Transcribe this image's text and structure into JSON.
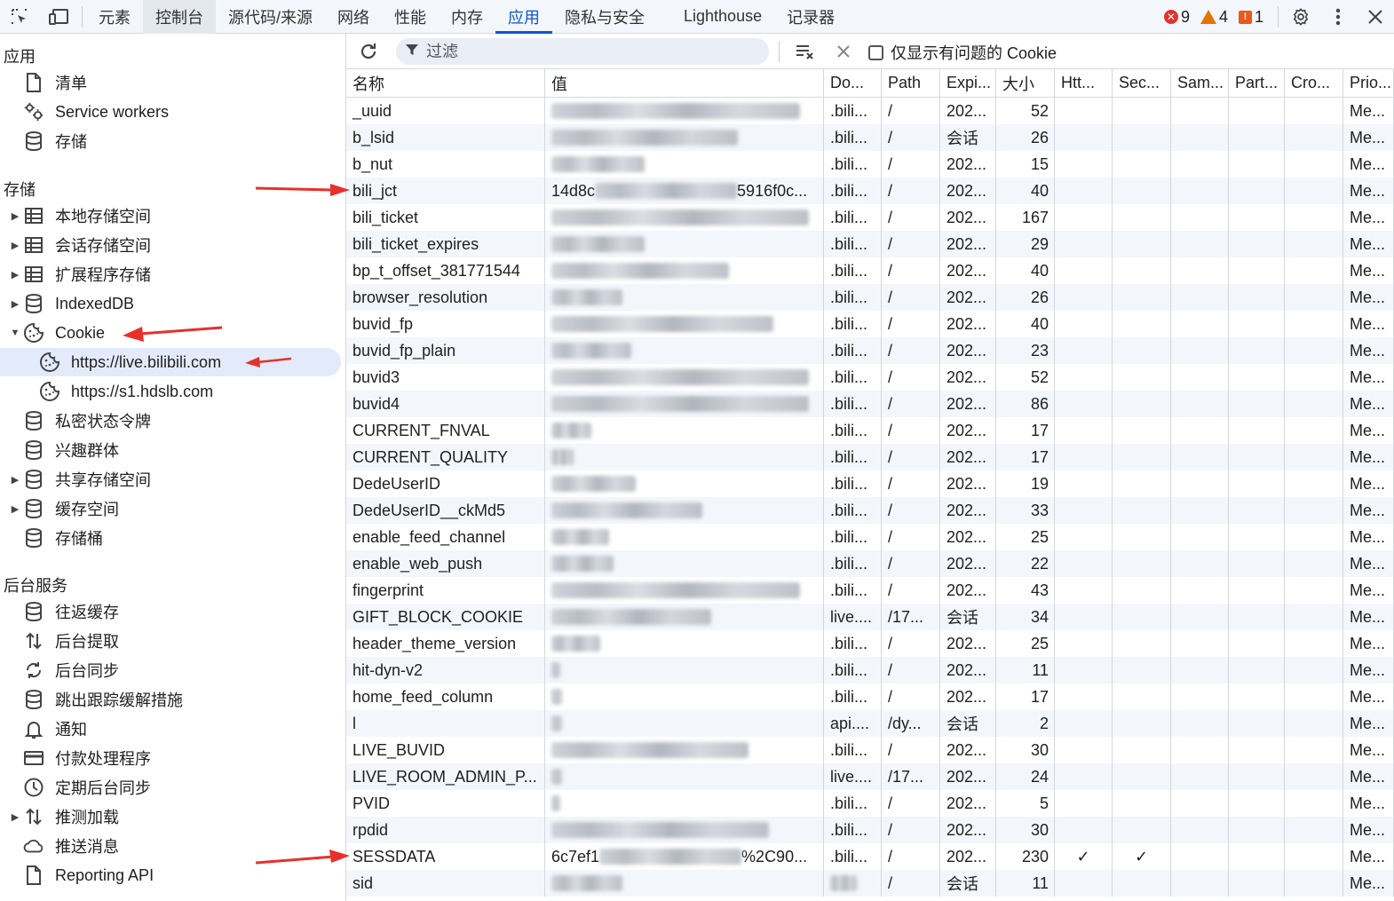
{
  "toolbar": {
    "tabs": [
      "元素",
      "控制台",
      "源代码/来源",
      "网络",
      "性能",
      "内存",
      "应用",
      "隐私与安全",
      "Lighthouse",
      "记录器"
    ],
    "errors": "9",
    "warnings": "4",
    "issues": "1"
  },
  "sidebar": {
    "section_app": "应用",
    "app_items": [
      "清单",
      "Service workers",
      "存储"
    ],
    "section_storage": "存储",
    "storage_items": [
      "本地存储空间",
      "会话存储空间",
      "扩展程序存储",
      "IndexedDB",
      "Cookie"
    ],
    "cookie_children": [
      "https://live.bilibili.com",
      "https://s1.hdslb.com"
    ],
    "storage_items_2": [
      "私密状态令牌",
      "兴趣群体",
      "共享存储空间",
      "缓存空间",
      "存储桶"
    ],
    "section_bg": "后台服务",
    "bg_items": [
      "往返缓存",
      "后台提取",
      "后台同步",
      "跳出跟踪缓解措施",
      "通知",
      "付款处理程序",
      "定期后台同步",
      "推测加载",
      "推送消息",
      "Reporting API"
    ]
  },
  "filter": {
    "placeholder": "过滤",
    "only_issues_label": "仅显示有问题的 Cookie"
  },
  "table": {
    "columns": [
      "名称",
      "值",
      "Do...",
      "Path",
      "Expi...",
      "大小",
      "Htt...",
      "Sec...",
      "Sam...",
      "Part...",
      "Cro...",
      "Prio..."
    ],
    "rows": [
      {
        "name": "_uuid",
        "value_prefix": "",
        "value_suffix": "",
        "domain": ".bili...",
        "path": "/",
        "expires": "202...",
        "size": "52",
        "http": "",
        "secure": "",
        "priority": "Me..."
      },
      {
        "name": "b_lsid",
        "value_prefix": "",
        "value_suffix": "",
        "domain": ".bili...",
        "path": "/",
        "expires": "会话",
        "size": "26",
        "http": "",
        "secure": "",
        "priority": "Me..."
      },
      {
        "name": "b_nut",
        "value_prefix": "",
        "value_suffix": "",
        "domain": ".bili...",
        "path": "/",
        "expires": "202...",
        "size": "15",
        "http": "",
        "secure": "",
        "priority": "Me..."
      },
      {
        "name": "bili_jct",
        "value_prefix": "14d8c",
        "value_suffix": "5916f0c...",
        "domain": ".bili...",
        "path": "/",
        "expires": "202...",
        "size": "40",
        "http": "",
        "secure": "",
        "priority": "Me..."
      },
      {
        "name": "bili_ticket",
        "value_prefix": "",
        "value_suffix": "",
        "domain": ".bili...",
        "path": "/",
        "expires": "202...",
        "size": "167",
        "http": "",
        "secure": "",
        "priority": "Me..."
      },
      {
        "name": "bili_ticket_expires",
        "value_prefix": "",
        "value_suffix": "",
        "domain": ".bili...",
        "path": "/",
        "expires": "202...",
        "size": "29",
        "http": "",
        "secure": "",
        "priority": "Me..."
      },
      {
        "name": "bp_t_offset_381771544",
        "value_prefix": "",
        "value_suffix": "",
        "domain": ".bili...",
        "path": "/",
        "expires": "202...",
        "size": "40",
        "http": "",
        "secure": "",
        "priority": "Me..."
      },
      {
        "name": "browser_resolution",
        "value_prefix": "",
        "value_suffix": "",
        "domain": ".bili...",
        "path": "/",
        "expires": "202...",
        "size": "26",
        "http": "",
        "secure": "",
        "priority": "Me..."
      },
      {
        "name": "buvid_fp",
        "value_prefix": "",
        "value_suffix": "",
        "domain": ".bili...",
        "path": "/",
        "expires": "202...",
        "size": "40",
        "http": "",
        "secure": "",
        "priority": "Me..."
      },
      {
        "name": "buvid_fp_plain",
        "value_prefix": "",
        "value_suffix": "",
        "domain": ".bili...",
        "path": "/",
        "expires": "202...",
        "size": "23",
        "http": "",
        "secure": "",
        "priority": "Me..."
      },
      {
        "name": "buvid3",
        "value_prefix": "",
        "value_suffix": "",
        "domain": ".bili...",
        "path": "/",
        "expires": "202...",
        "size": "52",
        "http": "",
        "secure": "",
        "priority": "Me..."
      },
      {
        "name": "buvid4",
        "value_prefix": "",
        "value_suffix": "",
        "domain": ".bili...",
        "path": "/",
        "expires": "202...",
        "size": "86",
        "http": "",
        "secure": "",
        "priority": "Me..."
      },
      {
        "name": "CURRENT_FNVAL",
        "value_prefix": "",
        "value_suffix": "",
        "domain": ".bili...",
        "path": "/",
        "expires": "202...",
        "size": "17",
        "http": "",
        "secure": "",
        "priority": "Me..."
      },
      {
        "name": "CURRENT_QUALITY",
        "value_prefix": "",
        "value_suffix": "",
        "domain": ".bili...",
        "path": "/",
        "expires": "202...",
        "size": "17",
        "http": "",
        "secure": "",
        "priority": "Me..."
      },
      {
        "name": "DedeUserID",
        "value_prefix": "",
        "value_suffix": "",
        "domain": ".bili...",
        "path": "/",
        "expires": "202...",
        "size": "19",
        "http": "",
        "secure": "",
        "priority": "Me..."
      },
      {
        "name": "DedeUserID__ckMd5",
        "value_prefix": "",
        "value_suffix": "",
        "domain": ".bili...",
        "path": "/",
        "expires": "202...",
        "size": "33",
        "http": "",
        "secure": "",
        "priority": "Me..."
      },
      {
        "name": "enable_feed_channel",
        "value_prefix": "",
        "value_suffix": "",
        "domain": ".bili...",
        "path": "/",
        "expires": "202...",
        "size": "25",
        "http": "",
        "secure": "",
        "priority": "Me..."
      },
      {
        "name": "enable_web_push",
        "value_prefix": "",
        "value_suffix": "",
        "domain": ".bili...",
        "path": "/",
        "expires": "202...",
        "size": "22",
        "http": "",
        "secure": "",
        "priority": "Me..."
      },
      {
        "name": "fingerprint",
        "value_prefix": "",
        "value_suffix": "",
        "domain": ".bili...",
        "path": "/",
        "expires": "202...",
        "size": "43",
        "http": "",
        "secure": "",
        "priority": "Me..."
      },
      {
        "name": "GIFT_BLOCK_COOKIE",
        "value_prefix": "",
        "value_suffix": "",
        "domain": "live....",
        "path": "/17...",
        "expires": "会话",
        "size": "34",
        "http": "",
        "secure": "",
        "priority": "Me..."
      },
      {
        "name": "header_theme_version",
        "value_prefix": "",
        "value_suffix": "",
        "domain": ".bili...",
        "path": "/",
        "expires": "202...",
        "size": "25",
        "http": "",
        "secure": "",
        "priority": "Me..."
      },
      {
        "name": "hit-dyn-v2",
        "value_prefix": "",
        "value_suffix": "",
        "domain": ".bili...",
        "path": "/",
        "expires": "202...",
        "size": "11",
        "http": "",
        "secure": "",
        "priority": "Me..."
      },
      {
        "name": "home_feed_column",
        "value_prefix": "",
        "value_suffix": "",
        "domain": ".bili...",
        "path": "/",
        "expires": "202...",
        "size": "17",
        "http": "",
        "secure": "",
        "priority": "Me..."
      },
      {
        "name": "l",
        "value_prefix": "",
        "value_suffix": "",
        "domain": "api....",
        "path": "/dy...",
        "expires": "会话",
        "size": "2",
        "http": "",
        "secure": "",
        "priority": "Me..."
      },
      {
        "name": "LIVE_BUVID",
        "value_prefix": "",
        "value_suffix": "",
        "domain": ".bili...",
        "path": "/",
        "expires": "202...",
        "size": "30",
        "http": "",
        "secure": "",
        "priority": "Me..."
      },
      {
        "name": "LIVE_ROOM_ADMIN_P...",
        "value_prefix": "",
        "value_suffix": "",
        "domain": "live....",
        "path": "/17...",
        "expires": "202...",
        "size": "24",
        "http": "",
        "secure": "",
        "priority": "Me..."
      },
      {
        "name": "PVID",
        "value_prefix": "",
        "value_suffix": "",
        "domain": ".bili...",
        "path": "/",
        "expires": "202...",
        "size": "5",
        "http": "",
        "secure": "",
        "priority": "Me..."
      },
      {
        "name": "rpdid",
        "value_prefix": "",
        "value_suffix": "",
        "domain": ".bili...",
        "path": "/",
        "expires": "202...",
        "size": "30",
        "http": "",
        "secure": "",
        "priority": "Me..."
      },
      {
        "name": "SESSDATA",
        "value_prefix": "6c7ef1",
        "value_suffix": "%2C90...",
        "domain": ".bili...",
        "path": "/",
        "expires": "202...",
        "size": "230",
        "http": "✓",
        "secure": "✓",
        "priority": "Me..."
      },
      {
        "name": "sid",
        "value_prefix": "",
        "value_suffix": "",
        "domain": "",
        "path": "/",
        "expires": "会话",
        "size": "11",
        "http": "",
        "secure": "",
        "priority": "Me..."
      }
    ]
  },
  "colors": {
    "accent": "#0b57d0",
    "arrow": "#e8302a",
    "error": "#dc362e",
    "warning": "#e37400"
  }
}
